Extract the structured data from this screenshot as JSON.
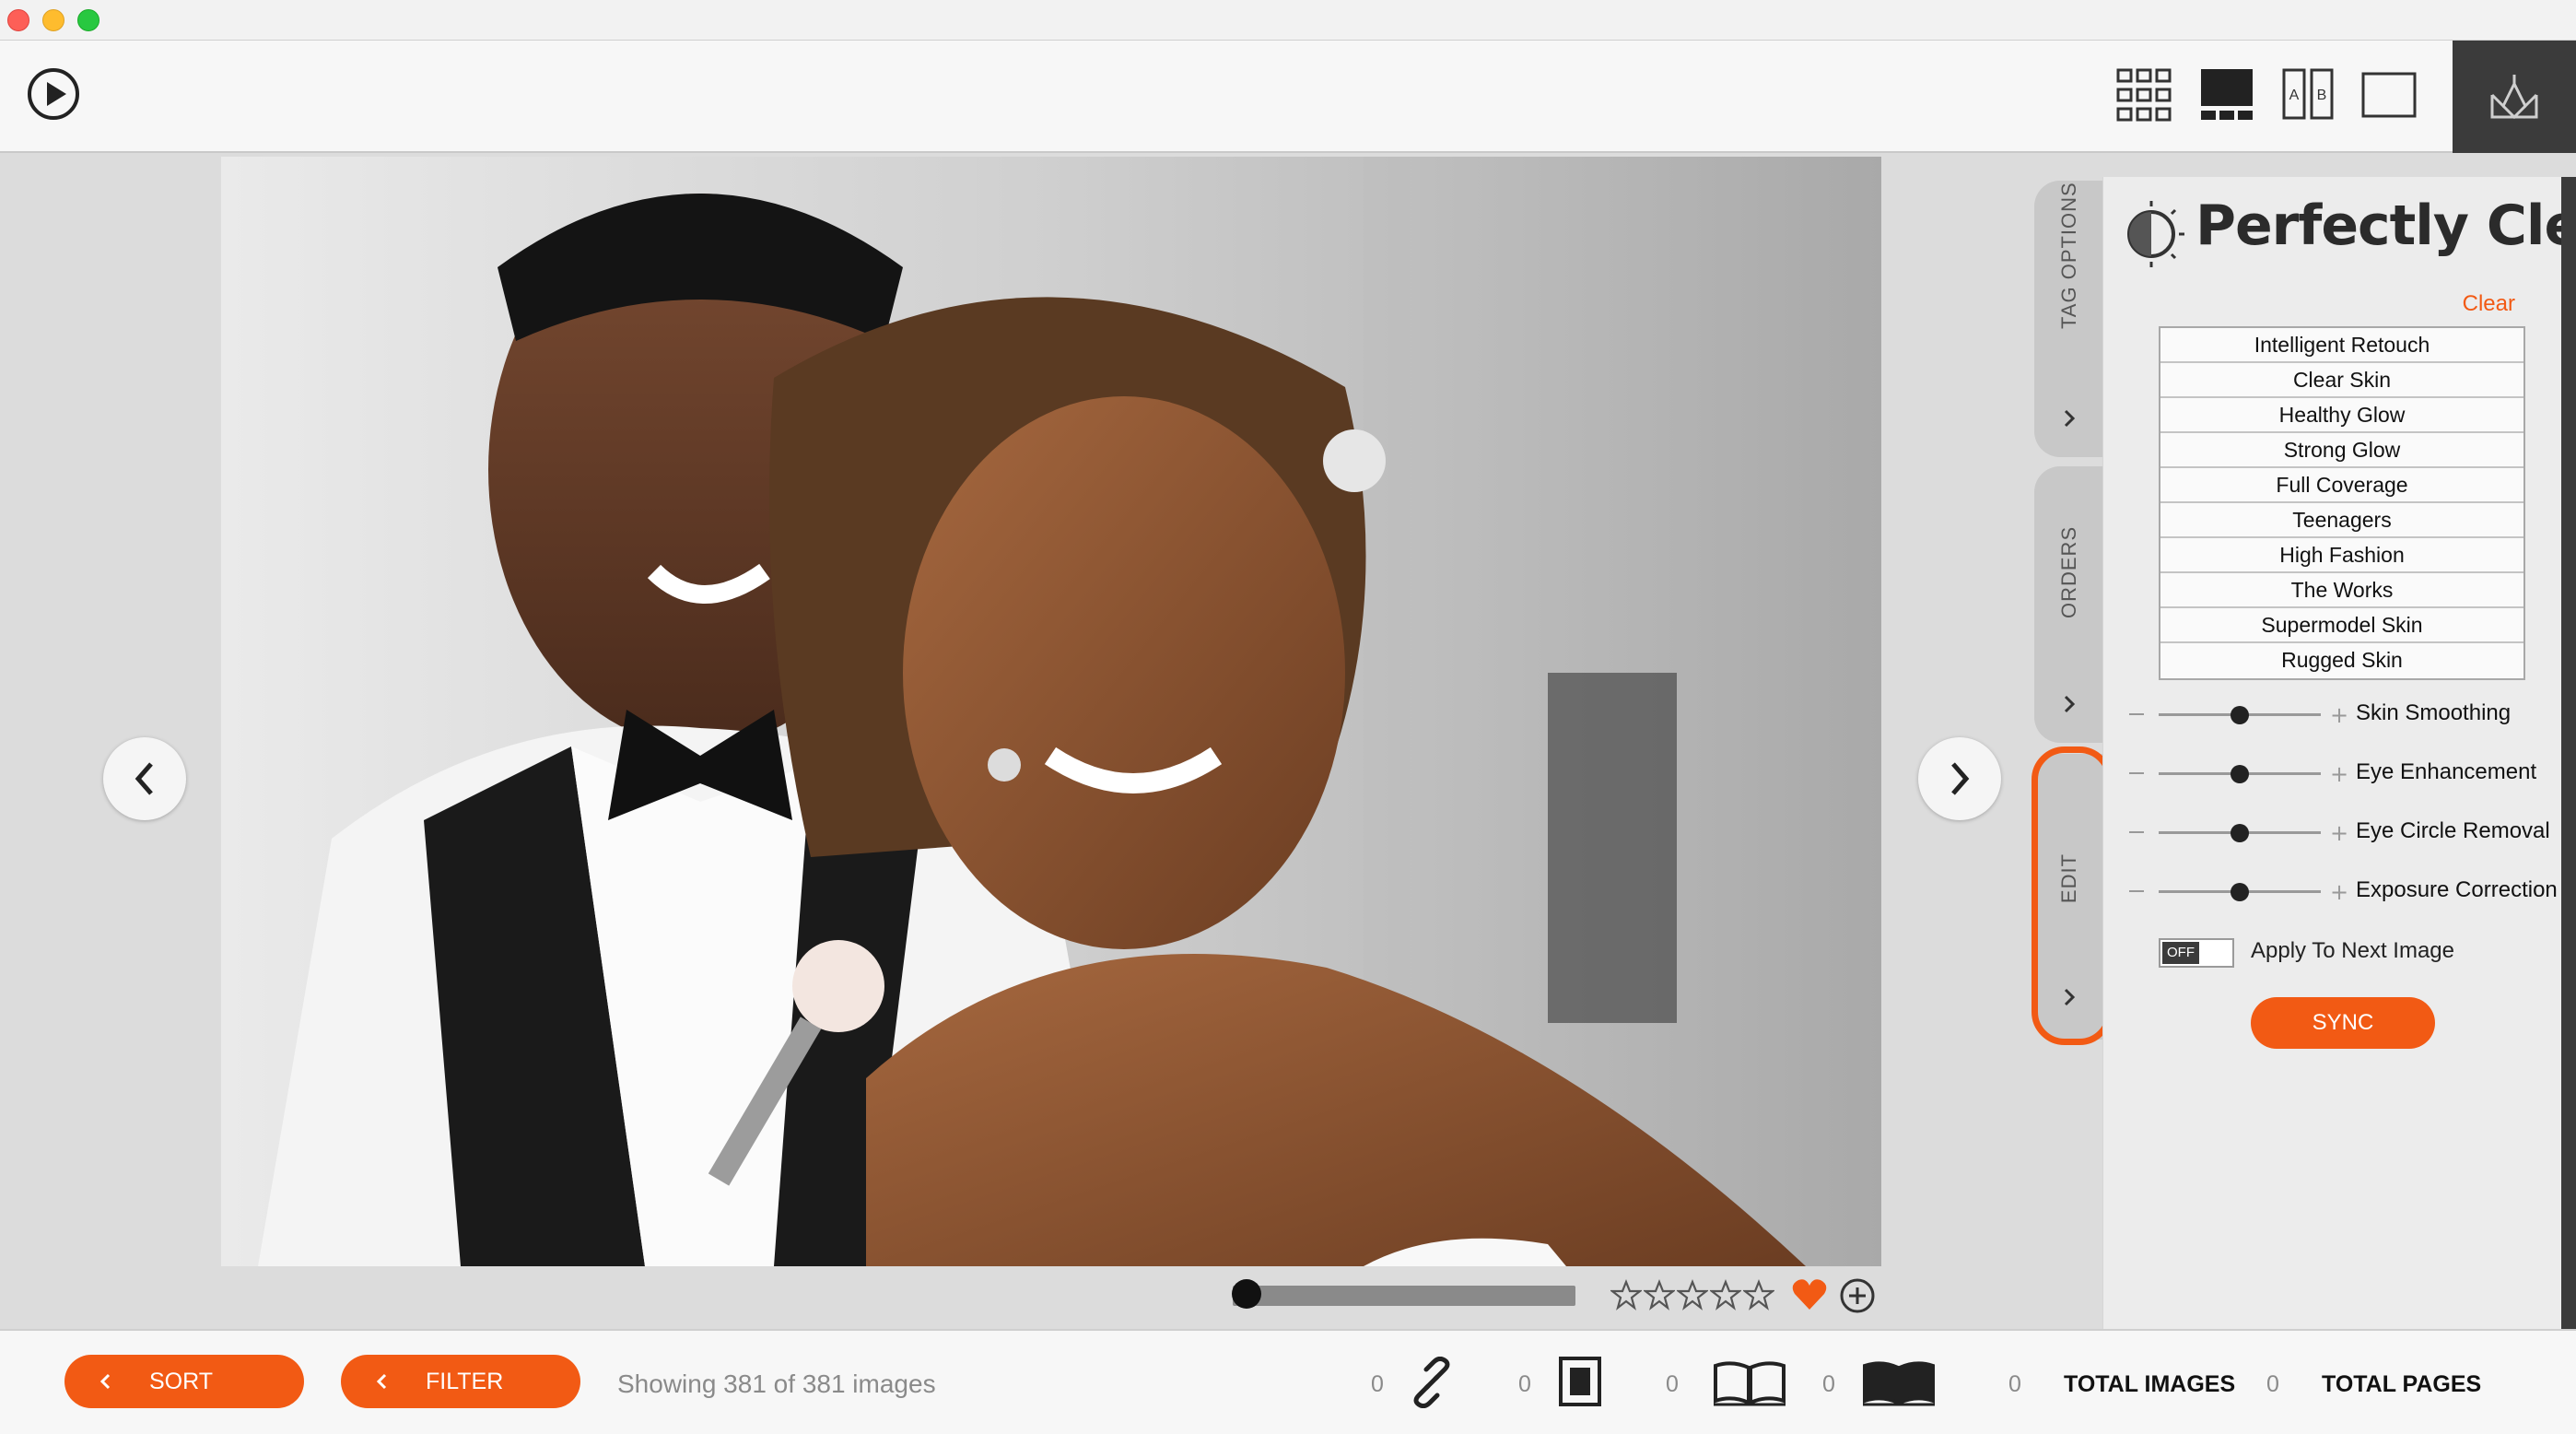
{
  "panel": {
    "title": "Perfectly Clear",
    "clear_label": "Clear",
    "presets": [
      "Intelligent Retouch",
      "Clear Skin",
      "Healthy Glow",
      "Strong Glow",
      "Full Coverage",
      "Teenagers",
      "High Fashion",
      "The Works",
      "Supermodel Skin",
      "Rugged Skin"
    ],
    "sliders": [
      {
        "label": "Skin Smoothing",
        "value": 0.5
      },
      {
        "label": "Eye Enhancement",
        "value": 0.5
      },
      {
        "label": "Eye Circle Removal",
        "value": 0.5
      },
      {
        "label": "Exposure Correction",
        "value": 0.5
      }
    ],
    "apply_toggle": "OFF",
    "apply_label": "Apply To Next Image",
    "sync_label": "SYNC"
  },
  "tabs": {
    "tag_options": "TAG OPTIONS",
    "orders": "ORDERS",
    "edit": "EDIT"
  },
  "viewer": {
    "scrub_position": 0.0,
    "rating": 0,
    "favorite": true
  },
  "bottom": {
    "sort_label": "SORT",
    "filter_label": "FILTER",
    "showing_text": "Showing 381 of 381 images",
    "counts": {
      "link": "0",
      "single": "0",
      "album_open": "0",
      "album_dark": "0",
      "total_images": "0"
    },
    "total_images_label": "TOTAL IMAGES",
    "total_pages_label": "TOTAL PAGES"
  },
  "colors": {
    "accent": "#f25a14",
    "dark": "#3b3b3b"
  }
}
